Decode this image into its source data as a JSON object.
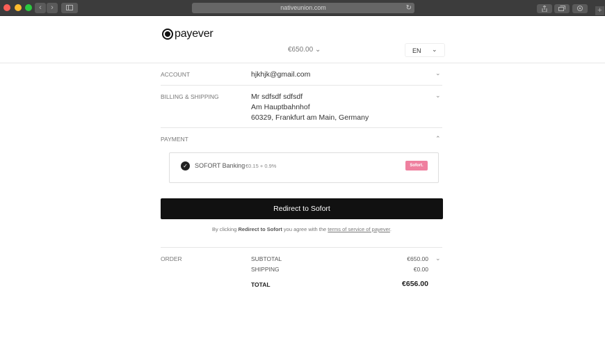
{
  "browser": {
    "url": "nativeunion.com",
    "back_glyph": "‹",
    "forward_glyph": "›",
    "reload_glyph": "↻",
    "new_tab_glyph": "+"
  },
  "header": {
    "brand": "payever",
    "amount": "€650.00",
    "amount_chevron": "⌄",
    "language": "EN",
    "language_chevron": "⌄"
  },
  "account": {
    "label": "ACCOUNT",
    "email": "hjkhjk@gmail.com",
    "chevron": "⌄"
  },
  "billing": {
    "label": "BILLING & SHIPPING",
    "name": "Mr sdfsdf sdfsdf",
    "street": "Am Hauptbahnhof",
    "city": "60329, Frankfurt am Main, Germany",
    "chevron": "⌄"
  },
  "payment": {
    "label": "PAYMENT",
    "chevron": "⌃",
    "method_name": "SOFORT Banking",
    "method_fee": "€0.15 + 0.9%",
    "method_logo": "Sofort.",
    "check_glyph": "✓"
  },
  "cta": {
    "label": "Redirect to Sofort",
    "terms_prefix": "By clicking ",
    "terms_bold": "Redirect to Sofort",
    "terms_middle": " you agree with the ",
    "terms_link": "terms of service of payever",
    "terms_suffix": "."
  },
  "order": {
    "label": "ORDER",
    "chevron": "⌄",
    "rows": [
      {
        "label": "SUBTOTAL",
        "value": "€650.00"
      },
      {
        "label": "SHIPPING",
        "value": "€0.00"
      }
    ],
    "total_label": "TOTAL",
    "total_value": "€656.00"
  }
}
